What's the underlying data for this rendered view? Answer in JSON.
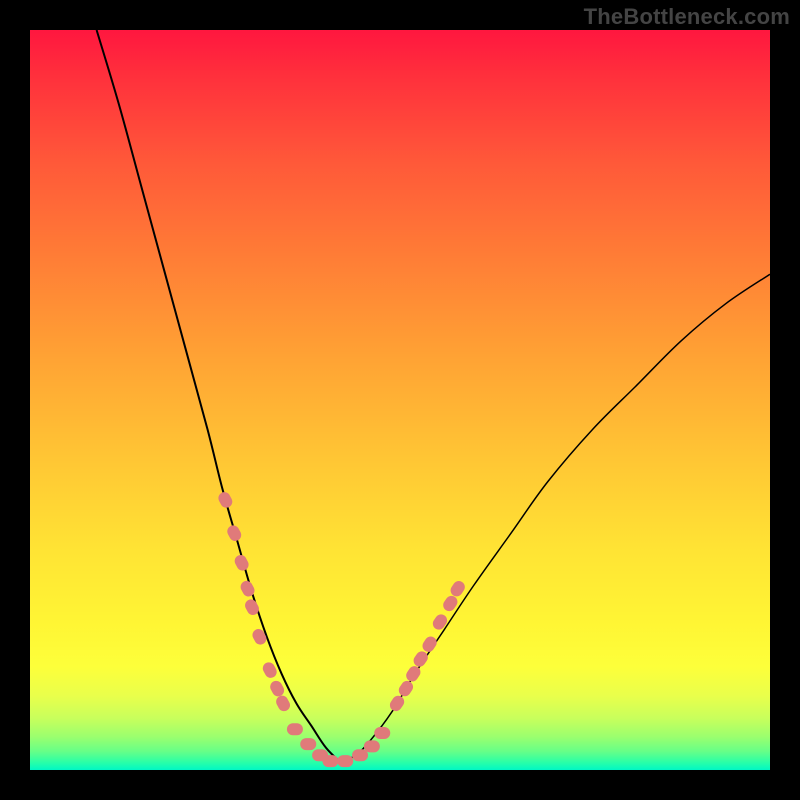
{
  "watermark": "TheBottleneck.com",
  "chart_data": {
    "type": "line",
    "title": "",
    "xlabel": "",
    "ylabel": "",
    "xlim": [
      0,
      100
    ],
    "ylim": [
      0,
      100
    ],
    "grid": false,
    "legend": false,
    "series": [
      {
        "name": "left-branch",
        "x": [
          9,
          12,
          15,
          18,
          21,
          24,
          26,
          28,
          30,
          32,
          34,
          36,
          38,
          40,
          42
        ],
        "y": [
          100,
          90,
          79,
          68,
          57,
          46,
          38,
          31,
          24,
          18,
          13,
          9,
          6,
          3,
          1
        ]
      },
      {
        "name": "right-branch",
        "x": [
          42,
          44,
          46,
          49,
          52,
          56,
          60,
          65,
          70,
          76,
          82,
          88,
          94,
          100
        ],
        "y": [
          1,
          2,
          4,
          8,
          13,
          19,
          25,
          32,
          39,
          46,
          52,
          58,
          63,
          67
        ]
      },
      {
        "name": "markers-left-slope",
        "x": [
          26.4,
          27.6,
          28.6,
          29.4,
          30.0,
          31.0,
          32.4,
          33.4,
          34.2
        ],
        "y": [
          36.5,
          32.0,
          28.0,
          24.5,
          22.0,
          18.0,
          13.5,
          11.0,
          9.0
        ]
      },
      {
        "name": "markers-bottom",
        "x": [
          35.8,
          37.6,
          39.2,
          40.6,
          42.6,
          44.6,
          46.2,
          47.6
        ],
        "y": [
          5.5,
          3.5,
          2.0,
          1.2,
          1.2,
          2.0,
          3.2,
          5.0
        ]
      },
      {
        "name": "markers-right-slope",
        "x": [
          49.6,
          50.8,
          51.8,
          52.8,
          54.0,
          55.4,
          56.8,
          57.8
        ],
        "y": [
          9.0,
          11.0,
          13.0,
          15.0,
          17.0,
          20.0,
          22.5,
          24.5
        ]
      }
    ],
    "background_gradient": {
      "top": "#ff173f",
      "mid": "#fff534",
      "bottom": "#00f7c5"
    },
    "marker_color": "#e07a7a"
  }
}
